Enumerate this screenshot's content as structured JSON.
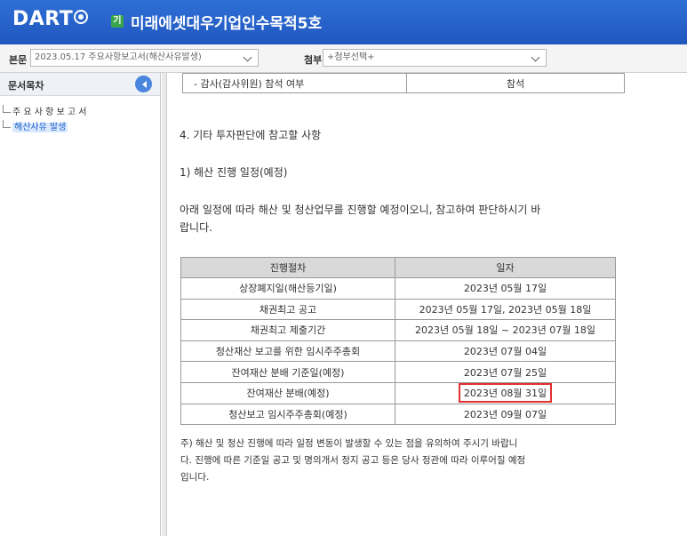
{
  "header": {
    "logo": "DART",
    "corp_badge": "기",
    "corp_name": "미래에셋대우기업인수목적5호"
  },
  "toolbar": {
    "main_label": "본문",
    "main_select": "2023.05.17  주요사항보고서(해산사유발생)",
    "attach_label": "첨부",
    "attach_select": "+첨부선택+"
  },
  "sidebar": {
    "title": "문서목차",
    "items": [
      {
        "label": "주 요 사 항 보 고 서"
      },
      {
        "label": "해산사유 발생"
      }
    ]
  },
  "content": {
    "top_row": {
      "left": "- 감사(감사위원) 참석 여부",
      "right": "참석"
    },
    "section_title": "4. 기타 투자판단에 참고할 사항",
    "sub_title": "1) 해산 진행 일정(예정)",
    "intro_line1": "아래 일정에 따라 해산 및 청산업무를 진행할 예정이오니, 참고하여 판단하시기 바",
    "intro_line2": "랍니다.",
    "schedule": {
      "headers": [
        "진행절차",
        "일자"
      ],
      "rows": [
        [
          "상장폐지일(해산등기일)",
          "2023년 05월 17일"
        ],
        [
          "채권최고 공고",
          "2023년 05월 17일, 2023년 05월 18일"
        ],
        [
          "채권최고 제출기간",
          "2023년 05월 18일 ~ 2023년 07월 18일"
        ],
        [
          "청산재산 보고를 위한 임시주주총회",
          "2023년 07월 04일"
        ],
        [
          "잔여재산 분배 기준일(예정)",
          "2023년 07월 25일"
        ],
        [
          "잔여재산 분배(예정)",
          "2023년 08월 31일"
        ],
        [
          "청산보고 임시주주총회(예정)",
          "2023년 09월 07일"
        ]
      ]
    },
    "note_line1": "주) 해산 및 청산 진행에 따라 일정 변동이 발생할 수 있는 점을 유의하여 주시기 바랍니",
    "note_line2": "다. 진행에 따른 기준일 공고 및 명의개서 정지 공고 등은 당사 정관에 따라 이루어질 예정",
    "note_line3": "입니다."
  },
  "colors": {
    "header_blue": "#2566cc",
    "highlight_red": "#e23030",
    "table_header_gray": "#d9d9d9"
  }
}
